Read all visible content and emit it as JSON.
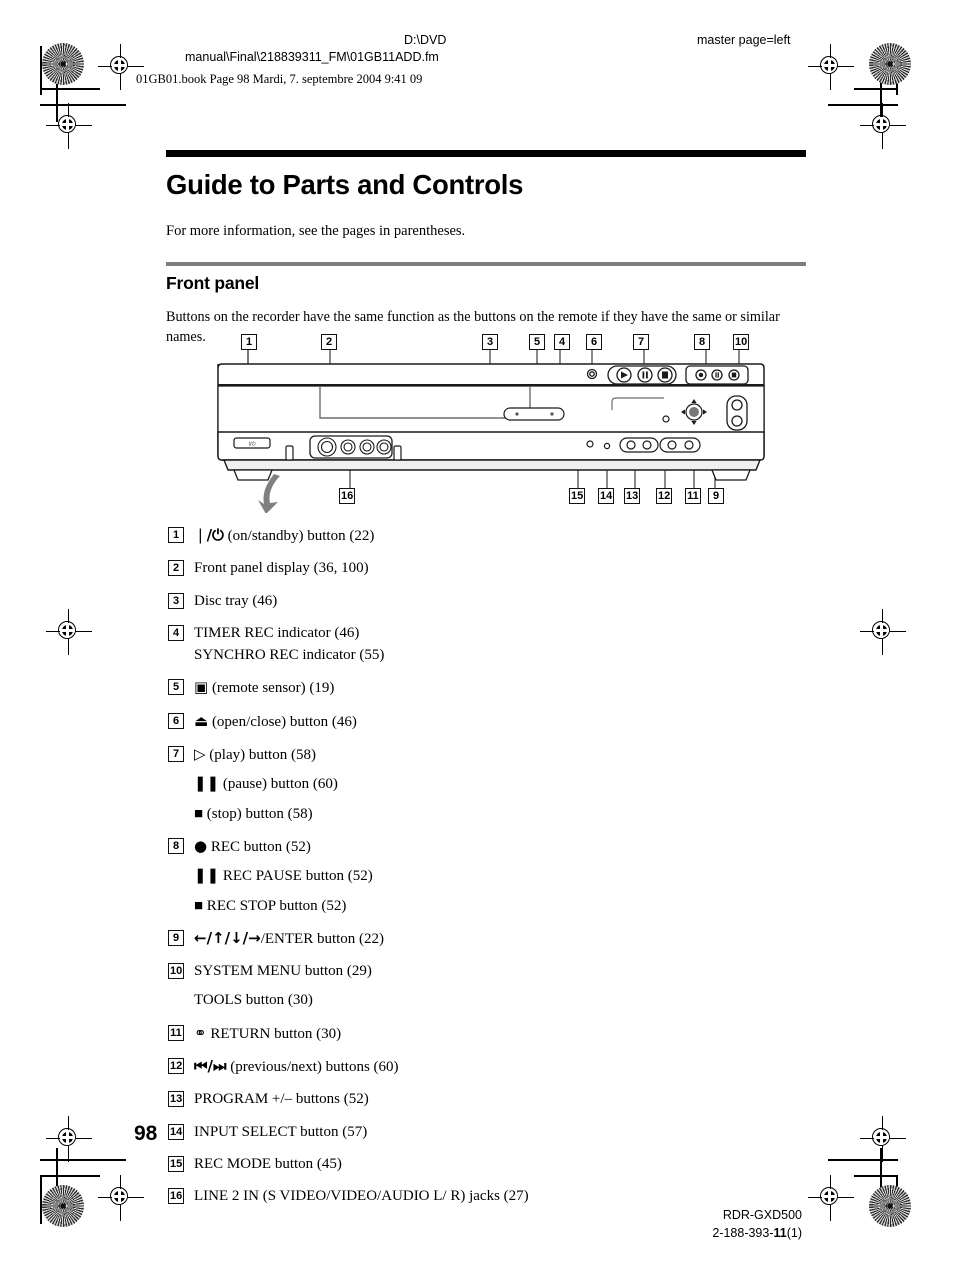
{
  "print_marks": {
    "header_path_line1": "D:\\DVD",
    "header_path_line2": "manual\\Final\\218839311_FM\\01GB11ADD.fm",
    "master_page": "master page=left",
    "book_stamp": "01GB01.book  Page 98  Mardi, 7. septembre 2004  9:41 09"
  },
  "document": {
    "title": "Guide to Parts and Controls",
    "intro": "For more information, see the pages in parentheses.",
    "section_heading": "Front panel",
    "section_lead": "Buttons on the recorder have the same function as the buttons on the remote if they have the same or similar names.",
    "page_number": "98"
  },
  "diagram": {
    "callouts_top": [
      "1",
      "2",
      "3",
      "5",
      "4",
      "6",
      "7",
      "8",
      "10"
    ],
    "callouts_bottom": [
      "16",
      "15",
      "14",
      "13",
      "12",
      "11",
      "9"
    ],
    "power_label": "I/⏻"
  },
  "parts": [
    {
      "num": "1",
      "icon": "power-on-standby-icon",
      "glyph": "❘/⏻",
      "text": " (on/standby) button (22)",
      "sub": []
    },
    {
      "num": "2",
      "icon": "",
      "glyph": "",
      "text": "Front panel display (36, 100)",
      "sub": []
    },
    {
      "num": "3",
      "icon": "",
      "glyph": "",
      "text": "Disc tray (46)",
      "sub": []
    },
    {
      "num": "4",
      "icon": "",
      "glyph": "",
      "text": "TIMER REC indicator (46)",
      "sub": [
        "SYNCHRO REC indicator (55)"
      ]
    },
    {
      "num": "5",
      "icon": "remote-sensor-icon",
      "glyph": "▣",
      "text": " (remote sensor) (19)",
      "sub": []
    },
    {
      "num": "6",
      "icon": "open-close-icon",
      "glyph": "⏏",
      "text": " (open/close) button (46)",
      "sub": []
    },
    {
      "num": "7",
      "icon": "play-icon",
      "glyph": "▷",
      "text": " (play) button (58)",
      "sub": [
        "❚❚ (pause) button (60)",
        "■ (stop) button (58)"
      ]
    },
    {
      "num": "8",
      "icon": "rec-icon",
      "glyph": "●",
      "text": " REC button (52)",
      "sub": [
        "❚❚ REC PAUSE button (52)",
        "■ REC STOP button (52)"
      ]
    },
    {
      "num": "9",
      "icon": "direction-pad-icon",
      "glyph": "←/↑/↓/→",
      "text": "/ENTER button (22)",
      "sub": []
    },
    {
      "num": "10",
      "icon": "",
      "glyph": "",
      "text": "SYSTEM MENU button (29)",
      "sub": [
        "TOOLS button (30)"
      ]
    },
    {
      "num": "11",
      "icon": "return-icon",
      "glyph": "⚭",
      "text": " RETURN button (30)",
      "sub": []
    },
    {
      "num": "12",
      "icon": "previous-next-icon",
      "glyph": "⏮/⏭",
      "text": " (previous/next) buttons (60)",
      "sub": []
    },
    {
      "num": "13",
      "icon": "",
      "glyph": "",
      "text": "PROGRAM +/– buttons (52)",
      "sub": []
    },
    {
      "num": "14",
      "icon": "",
      "glyph": "",
      "text": "INPUT SELECT button (57)",
      "sub": []
    },
    {
      "num": "15",
      "icon": "",
      "glyph": "",
      "text": "REC MODE button (45)",
      "sub": []
    },
    {
      "num": "16",
      "icon": "",
      "glyph": "",
      "text": "LINE 2 IN (S VIDEO/VIDEO/AUDIO L/ R) jacks (27)",
      "sub": []
    }
  ],
  "footer": {
    "model": "RDR-GXD500",
    "part_prefix": "2-188-393-",
    "part_bold": "11",
    "part_suffix": "(1)"
  }
}
